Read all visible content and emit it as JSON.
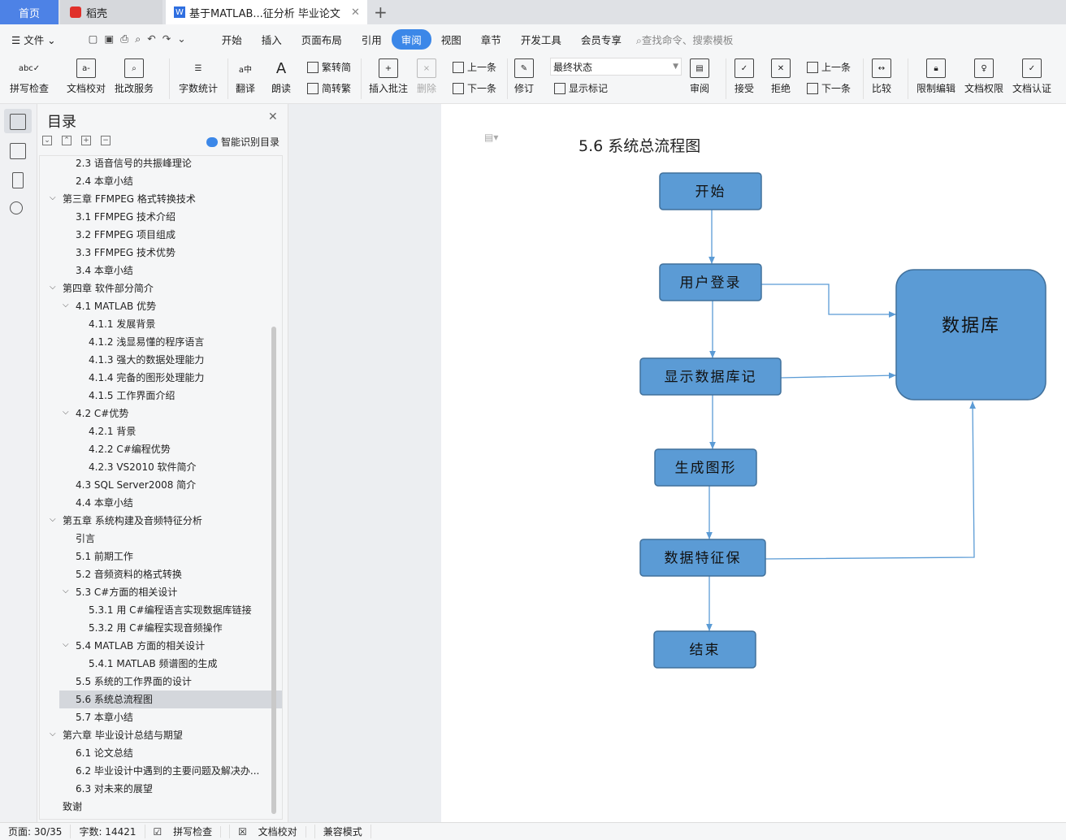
{
  "tabs": {
    "home": "首页",
    "daoke": "稻壳",
    "doc": "基于MATLAB...征分析 毕业论文"
  },
  "menu": {
    "file": "文件",
    "items": [
      "开始",
      "插入",
      "页面布局",
      "引用",
      "审阅",
      "视图",
      "章节",
      "开发工具",
      "会员专享"
    ],
    "active": "审阅",
    "search_placeholder": "查找命令、搜索模板"
  },
  "ribbon": {
    "spell": "拼写检查",
    "proof": "文档校对",
    "correct": "批改服务",
    "wordcount": "字数统计",
    "translate": "翻译",
    "read": "朗读",
    "trad_to_simp": "繁转简",
    "simp_to_trad": "简转繁",
    "insert_comment": "插入批注",
    "delete": "删除",
    "prev": "上一条",
    "next": "下一条",
    "revise": "修订",
    "state": "最终状态",
    "show_marks": "显示标记",
    "review": "审阅",
    "accept": "接受",
    "reject": "拒绝",
    "prev2": "上一条",
    "next2": "下一条",
    "compare": "比较",
    "restrict": "限制编辑",
    "perm": "文档权限",
    "auth": "文档认证"
  },
  "toc": {
    "title": "目录",
    "smart": "智能识别目录",
    "items": [
      {
        "t": "2.3 语音信号的共振峰理论",
        "l": 2
      },
      {
        "t": "2.4 本章小结",
        "l": 2
      },
      {
        "t": "第三章  FFMPEG 格式转换技术",
        "l": 1,
        "c": 1
      },
      {
        "t": "3.1 FFMPEG 技术介绍",
        "l": 2
      },
      {
        "t": "3.2 FFMPEG 项目组成",
        "l": 2
      },
      {
        "t": "3.3 FFMPEG 技术优势",
        "l": 2
      },
      {
        "t": "3.4 本章小结",
        "l": 2
      },
      {
        "t": "第四章  软件部分简介",
        "l": 1,
        "c": 1
      },
      {
        "t": "4.1 MATLAB 优势",
        "l": 2,
        "c": 1
      },
      {
        "t": "4.1.1 发展背景",
        "l": 3
      },
      {
        "t": "4.1.2  浅显易懂的程序语言",
        "l": 3
      },
      {
        "t": "4.1.3  强大的数据处理能力",
        "l": 3
      },
      {
        "t": "4.1.4  完备的图形处理能力",
        "l": 3
      },
      {
        "t": "4.1.5  工作界面介绍",
        "l": 3
      },
      {
        "t": "4.2 C#优势",
        "l": 2,
        "c": 1
      },
      {
        "t": "4.2.1 背景",
        "l": 3
      },
      {
        "t": "4.2.2 C#编程优势",
        "l": 3
      },
      {
        "t": "4.2.3 VS2010 软件简介",
        "l": 3
      },
      {
        "t": "4.3 SQL Server2008 简介",
        "l": 2
      },
      {
        "t": "4.4  本章小结",
        "l": 2
      },
      {
        "t": "第五章  系统构建及音频特征分析",
        "l": 1,
        "c": 1
      },
      {
        "t": "引言",
        "l": 2
      },
      {
        "t": "5.1  前期工作",
        "l": 2
      },
      {
        "t": "5.2  音频资料的格式转换",
        "l": 2
      },
      {
        "t": "5.3 C#方面的相关设计",
        "l": 2,
        "c": 1
      },
      {
        "t": "5.3.1 用 C#编程语言实现数据库链接",
        "l": 3
      },
      {
        "t": "5.3.2  用 C#编程实现音频操作",
        "l": 3
      },
      {
        "t": "5.4 MATLAB 方面的相关设计",
        "l": 2,
        "c": 1
      },
      {
        "t": "5.4.1 MATLAB 频谱图的生成",
        "l": 3
      },
      {
        "t": "5.5 系统的工作界面的设计",
        "l": 2
      },
      {
        "t": "5.6  系统总流程图",
        "l": 2,
        "s": 1
      },
      {
        "t": "5.7  本章小结",
        "l": 2
      },
      {
        "t": "第六章  毕业设计总结与期望",
        "l": 1,
        "c": 1
      },
      {
        "t": "6.1 论文总结",
        "l": 2
      },
      {
        "t": "6.2  毕业设计中遇到的主要问题及解决办...",
        "l": 2
      },
      {
        "t": "6.3  对未来的展望",
        "l": 2
      },
      {
        "t": "致谢",
        "l": 1
      }
    ]
  },
  "doc": {
    "heading": "5.6  系统总流程图",
    "nodes": {
      "start": "开始",
      "login": "用户登录",
      "show": "显示数据库记",
      "gen": "生成图形",
      "save": "数据特征保",
      "end": "结束",
      "db": "数据库"
    },
    "fill": "#5b9bd5",
    "stroke": "#41719c"
  },
  "status": {
    "page": "页面: 30/35",
    "words": "字数: 14421",
    "spell": "拼写检查",
    "proof": "文档校对",
    "compat": "兼容模式"
  }
}
